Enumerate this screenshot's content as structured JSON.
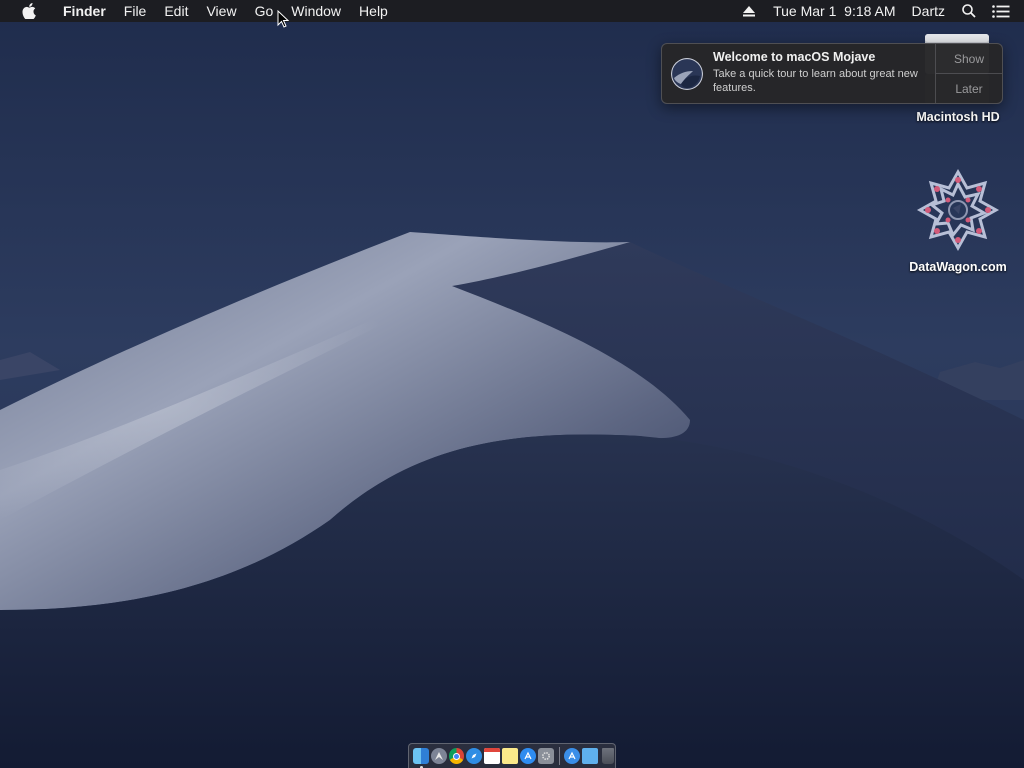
{
  "menubar": {
    "app_name": "Finder",
    "menus": [
      "File",
      "Edit",
      "View",
      "Go",
      "Window",
      "Help"
    ],
    "datetime": "Tue Mar 1  9:18 AM",
    "user": "Dartz"
  },
  "notification": {
    "title": "Welcome to macOS Mojave",
    "text": "Take a quick tour to learn about great new features.",
    "show_label": "Show",
    "later_label": "Later"
  },
  "desktop_icons": [
    {
      "label": "Macintosh HD",
      "icon": "hard-drive-icon"
    },
    {
      "label": "DataWagon.com",
      "icon": "datawagon-logo-icon"
    }
  ],
  "dock": {
    "items": [
      "finder-icon",
      "launchpad-icon",
      "chrome-icon",
      "safari-icon",
      "calendar-icon",
      "notes-icon",
      "app-store-icon",
      "system-preferences-icon",
      "applications-folder-icon",
      "folder-icon",
      "trash-icon"
    ]
  },
  "colors": {
    "menubar_bg": "#1c1c1e",
    "sky": "#2c3a5c",
    "dune_light": "#9aa3b8",
    "dune_dark": "#1c2742"
  }
}
